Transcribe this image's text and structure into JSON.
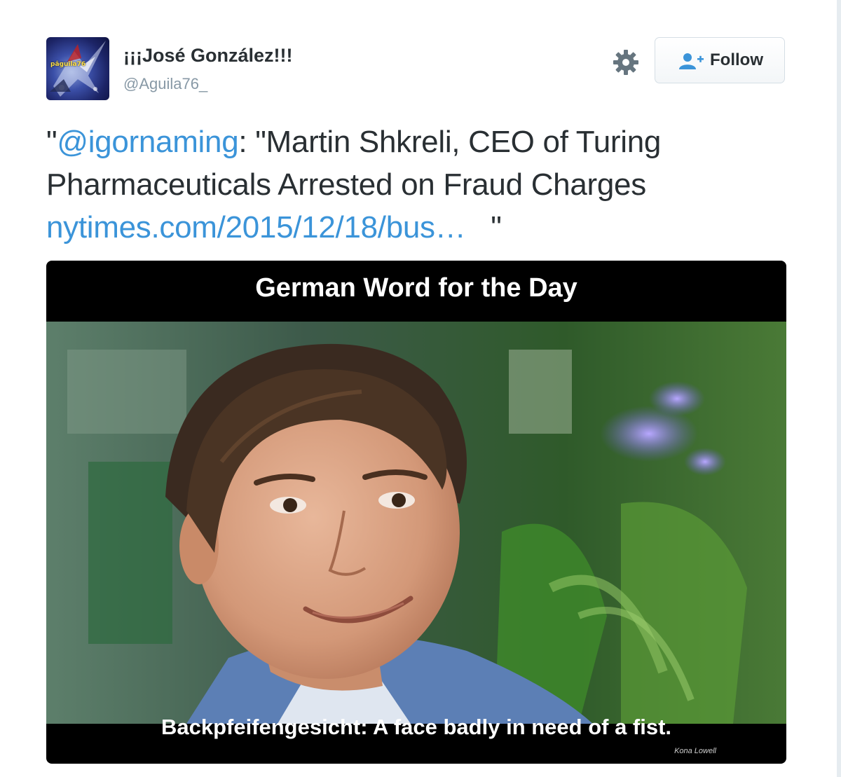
{
  "user": {
    "display_name": "¡¡¡José González!!!",
    "screen_name": "@Aguila76_",
    "avatar_text": "pâguila76",
    "avatar_icon": "user-avatar"
  },
  "actions": {
    "settings_icon": "gear-icon",
    "follow_label": "Follow",
    "follow_icon": "add-user-icon"
  },
  "tweet": {
    "open_quote": "\"",
    "mention": "@igornaming",
    "text_after_mention": ": \"Martin Shkreli, CEO of Turing Pharmaceuticals Arrested on Fraud Charges ",
    "link_text": "nytimes.com/2015/12/18/bus",
    "link_ellipsis": "…",
    "close_quote": "   \""
  },
  "media": {
    "title": "German Word for the Day",
    "caption": "Backpfeifengesicht: A face badly in need of a fist.",
    "credit": "Kona Lowell"
  },
  "colors": {
    "link": "#3b94d9",
    "text": "#292f33",
    "secondary": "#8899a6"
  }
}
